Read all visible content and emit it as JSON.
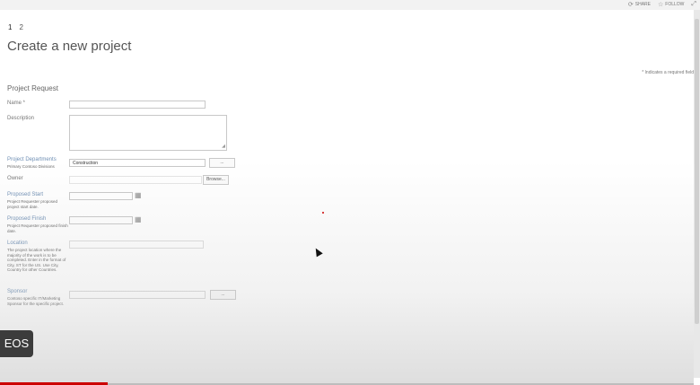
{
  "topbar": {
    "share_label": "SHARE",
    "follow_label": "FOLLOW"
  },
  "steps": [
    "1",
    "2"
  ],
  "page_title": "Create a new project",
  "required_note": "* Indicates a required field",
  "section_title": "Project Request",
  "fields": {
    "name": {
      "label": "Name *",
      "value": ""
    },
    "description": {
      "label": "Description",
      "value": ""
    },
    "departments": {
      "label": "Project Departments",
      "desc": "Primary Contoso Divisions",
      "value": "Construction",
      "button": "..."
    },
    "owner": {
      "label": "Owner",
      "value": "",
      "button": "Browse..."
    },
    "proposed_start": {
      "label": "Proposed Start",
      "desc": "Project Requester proposed project start date.",
      "value": ""
    },
    "proposed_finish": {
      "label": "Proposed Finish",
      "desc": "Project Requester proposed finish date.",
      "value": ""
    },
    "location": {
      "label": "Location",
      "desc": "The project location where the majority of the work is to be completed. Enter in the format of City, ST for the US. Use City, Country for other Countries.",
      "value": ""
    },
    "sponsor": {
      "label": "Sponsor",
      "desc": "Contoso specific IT/Marketing Sponsor for the specific project.",
      "value": "",
      "button": "..."
    }
  },
  "badge": "EOS",
  "colors": {
    "progress": "#cc0000",
    "link_label": "#6f8fb4"
  },
  "progress_fraction": 0.155
}
